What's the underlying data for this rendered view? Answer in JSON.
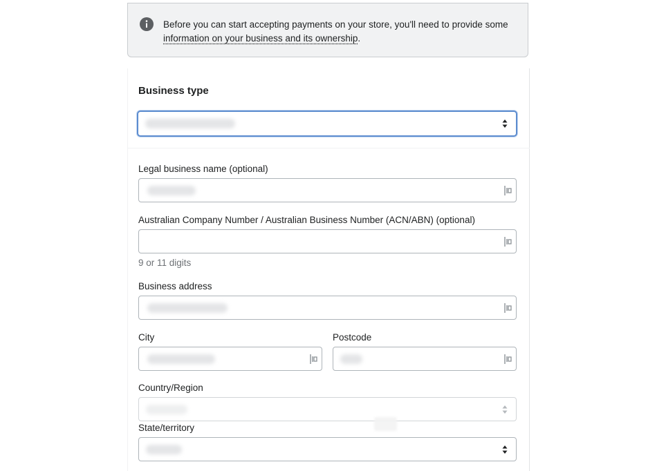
{
  "banner": {
    "message": "Before you can start accepting payments on your store, you'll need to provide some",
    "link_text": "information on your business and its ownership",
    "suffix": "."
  },
  "business_type": {
    "title": "Business type",
    "selected_value": ""
  },
  "form": {
    "legal_name": {
      "label": "Legal business name (optional)",
      "value": ""
    },
    "acn_abn": {
      "label": "Australian Company Number / Australian Business Number (ACN/ABN) (optional)",
      "value": "",
      "help": "9 or 11 digits"
    },
    "address": {
      "label": "Business address",
      "value": ""
    },
    "city": {
      "label": "City",
      "value": ""
    },
    "postcode": {
      "label": "Postcode",
      "value": ""
    },
    "country": {
      "label": "Country/Region",
      "value": ""
    },
    "state": {
      "label": "State/territory",
      "value": ""
    }
  },
  "colors": {
    "focus_border": "#5c8ccf",
    "banner_background": "#f1f2f3",
    "help_text": "#6d7175"
  },
  "icons": {
    "banner": "info-icon",
    "select": "select-arrows-icon",
    "autofill": "autofill-icon"
  }
}
